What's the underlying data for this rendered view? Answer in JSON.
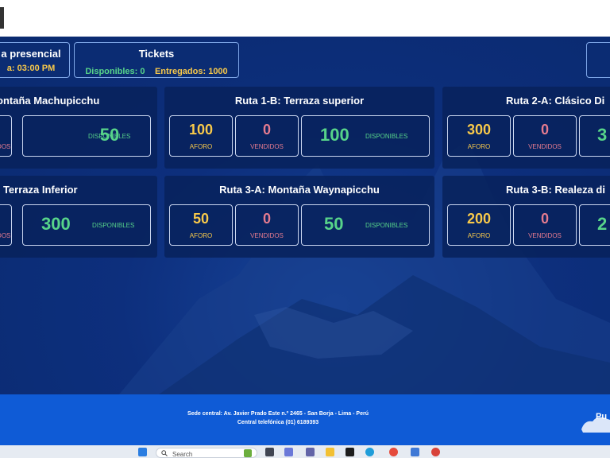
{
  "header": {
    "session_title": "a presencial",
    "session_time": "a: 03:00 PM",
    "tickets_title": "Tickets",
    "tickets_available": "Disponibles: 0",
    "tickets_delivered": "Entregados: 1000"
  },
  "labels": {
    "aforo": "AFORO",
    "vendidos": "VENDIDOS",
    "disponibles": "DISPONIBLES"
  },
  "routes": [
    {
      "title": "ontaña Machupicchu",
      "aforo": "",
      "vendidos": "",
      "disponibles": "50"
    },
    {
      "title": "Ruta 1-B: Terraza superior",
      "aforo": "100",
      "vendidos": "0",
      "disponibles": "100"
    },
    {
      "title": "Ruta 2-A: Clásico Di",
      "aforo": "300",
      "vendidos": "0",
      "disponibles": "3"
    },
    {
      "title": ": Terraza Inferior",
      "aforo": "",
      "vendidos": "",
      "disponibles": "300"
    },
    {
      "title": "Ruta 3-A: Montaña Waynapicchu",
      "aforo": "50",
      "vendidos": "0",
      "disponibles": "50"
    },
    {
      "title": "Ruta 3-B: Realeza di",
      "aforo": "200",
      "vendidos": "0",
      "disponibles": "2"
    }
  ],
  "footer": {
    "address": "Sede central: Av. Javier Prado Este n.º 2465 - San Borja - Lima - Perú",
    "phone": "Central telefónica (01) 6189393",
    "logo_text": "Pu"
  },
  "taskbar": {
    "search_placeholder": "Search"
  }
}
